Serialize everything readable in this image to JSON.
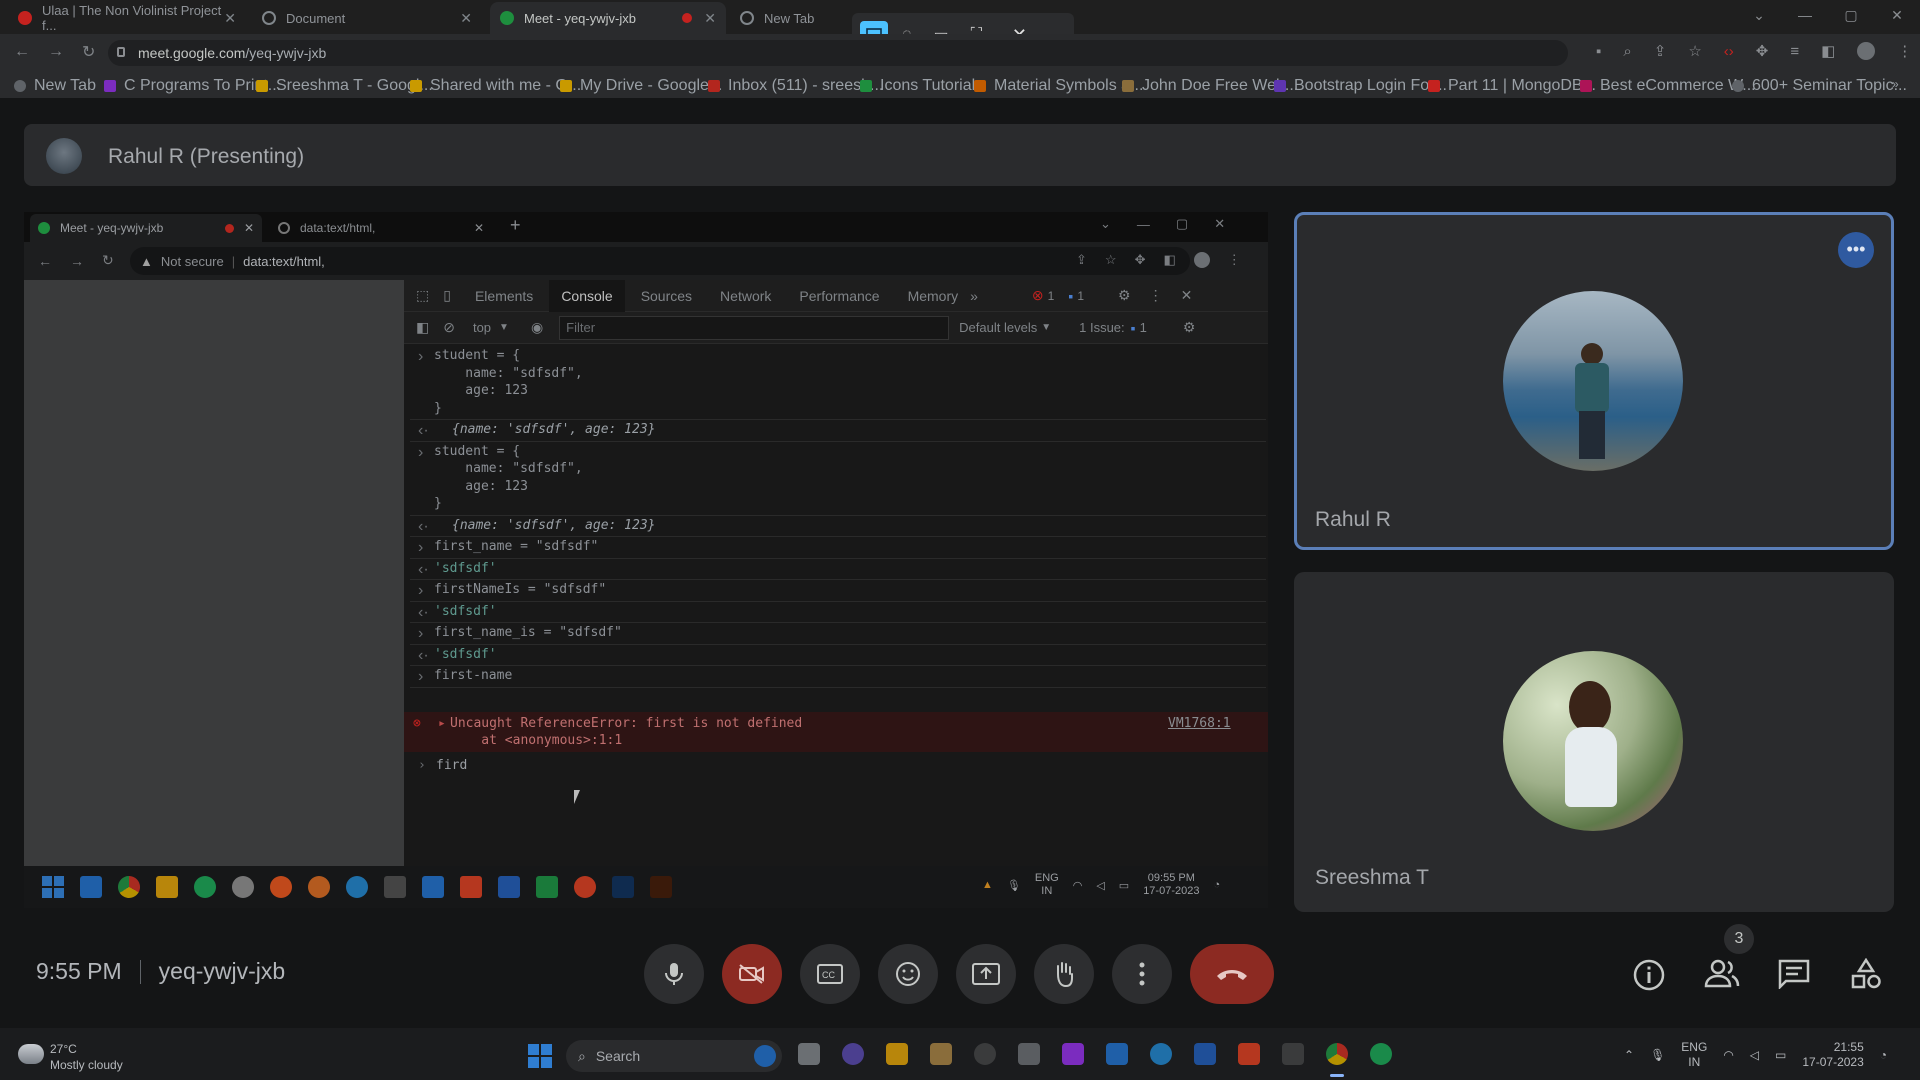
{
  "browser": {
    "tabs": [
      {
        "title": "Ulaa | The Non Violinist Project f...",
        "color": "#c5221f"
      },
      {
        "title": "Document",
        "color": "#5f6368"
      },
      {
        "title": "Meet - yeq-ywjv-jxb",
        "color": "#1e8e3e"
      },
      {
        "title": "New Tab",
        "color": "#5f6368"
      }
    ],
    "url_host": "meet.google.com",
    "url_path": "/yeq-ywjv-jxb",
    "bookmarks": [
      "New Tab",
      "C Programs To Print...",
      "Sreeshma T - Googl...",
      "Shared with me - G...",
      "My Drive - Google...",
      "Inbox (511) - sreesh...",
      "Icons Tutorial",
      "Material Symbols a...",
      "John Doe Free Web...",
      "Bootstrap Login For...",
      "Part 11 | MongoDB...",
      "Best eCommerce W...",
      "600+ Seminar Topic..."
    ]
  },
  "meet": {
    "presenter_label": "Rahul R (Presenting)",
    "participants": [
      "Rahul R",
      "Sreeshma T"
    ],
    "time": "9:55 PM",
    "meeting_code": "yeq-ywjv-jxb",
    "people_count": "3"
  },
  "shared_screen": {
    "tabs": [
      "Meet - yeq-ywjv-jxb",
      "data:text/html,"
    ],
    "not_secure": "Not secure",
    "url": "data:text/html,",
    "devtools_tabs": [
      "Elements",
      "Console",
      "Sources",
      "Network",
      "Performance",
      "Memory"
    ],
    "error_count": "1",
    "message_count": "1",
    "context": "top",
    "filter_placeholder": "Filter",
    "levels": "Default levels",
    "issues": "1 Issue:",
    "issues_count": "1",
    "console": [
      {
        "kind": "input",
        "lines": [
          "student = {",
          "    name: \"sdfsdf\",",
          "    age: 123",
          "}"
        ]
      },
      {
        "kind": "output",
        "lines": [
          "{name: 'sdfsdf', age: 123}"
        ]
      },
      {
        "kind": "input",
        "lines": [
          "student = {",
          "    name: \"sdfsdf\",",
          "    age: 123",
          "}"
        ]
      },
      {
        "kind": "output",
        "lines": [
          "{name: 'sdfsdf', age: 123}"
        ]
      },
      {
        "kind": "input",
        "lines": [
          "first_name = \"sdfsdf\""
        ]
      },
      {
        "kind": "output",
        "lines": [
          "'sdfsdf'"
        ]
      },
      {
        "kind": "input",
        "lines": [
          "firstNameIs = \"sdfsdf\""
        ]
      },
      {
        "kind": "output",
        "lines": [
          "'sdfsdf'"
        ]
      },
      {
        "kind": "input",
        "lines": [
          "first_name_is = \"sdfsdf\""
        ]
      },
      {
        "kind": "output",
        "lines": [
          "'sdfsdf'"
        ]
      },
      {
        "kind": "input",
        "lines": [
          "first-name"
        ]
      }
    ],
    "error_line1": "Uncaught ReferenceError: first is not defined",
    "error_line2": "    at <anonymous>:1:1",
    "error_src": "VM1768:1",
    "prompt_text": "fird",
    "tray_lang": "ENG",
    "tray_region": "IN",
    "tray_time": "09:55 PM",
    "tray_date": "17-07-2023"
  },
  "taskbar": {
    "weather_temp": "27°C",
    "weather_desc": "Mostly cloudy",
    "search_placeholder": "Search",
    "lang": "ENG",
    "region": "IN",
    "time": "21:55",
    "date": "17-07-2023"
  }
}
